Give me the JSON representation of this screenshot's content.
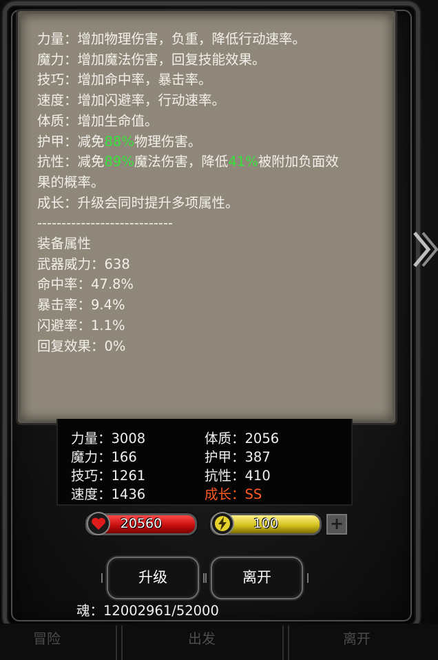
{
  "panel": {
    "lines": [
      {
        "parts": [
          {
            "t": "力量：增加物理伤害，负重，降低行动速率。"
          }
        ]
      },
      {
        "parts": [
          {
            "t": "魔力：增加魔法伤害，回复技能效果。"
          }
        ]
      },
      {
        "parts": [
          {
            "t": "技巧：增加命中率，暴击率。"
          }
        ]
      },
      {
        "parts": [
          {
            "t": "速度：增加闪避率，行动速率。"
          }
        ]
      },
      {
        "parts": [
          {
            "t": "体质：增加生命值。"
          }
        ]
      },
      {
        "parts": [
          {
            "t": "护甲：减免"
          },
          {
            "t": "88%",
            "g": true
          },
          {
            "t": "物理伤害。"
          }
        ]
      },
      {
        "parts": [
          {
            "t": "抗性：减免"
          },
          {
            "t": "89%",
            "g": true
          },
          {
            "t": "魔法伤害，降低"
          },
          {
            "t": "41%",
            "g": true
          },
          {
            "t": "被附加负面效果的概率。"
          }
        ]
      },
      {
        "parts": [
          {
            "t": "成长：升级会同时提升多项属性。"
          }
        ]
      },
      {
        "parts": [
          {
            "t": "----------------------------"
          }
        ]
      },
      {
        "parts": [
          {
            "t": "装备属性"
          }
        ]
      },
      {
        "parts": [
          {
            "t": "武器威力：638"
          }
        ]
      },
      {
        "parts": [
          {
            "t": "命中率：47.8%"
          }
        ]
      },
      {
        "parts": [
          {
            "t": "暴击率：9.4%"
          }
        ]
      },
      {
        "parts": [
          {
            "t": "闪避率：1.1%"
          }
        ]
      },
      {
        "parts": [
          {
            "t": "回复效果：0%"
          }
        ]
      }
    ]
  },
  "stats": {
    "strength": "力量：3008",
    "magic": "魔力：166",
    "skill": "技巧：1261",
    "speed": "速度：1436",
    "constitution": "体质：2056",
    "armor": "护甲：387",
    "resistance": "抗性：410",
    "growth": "成长：SS"
  },
  "bars": {
    "hp": "20560",
    "energy": "100"
  },
  "plus_label": "+",
  "buttons": {
    "upgrade": "升级",
    "leave": "离开"
  },
  "soul": "魂：12002961/52000",
  "bottom_tabs": {
    "adventure": "冒险",
    "depart": "出发",
    "leave": "离开"
  },
  "colors": {
    "green": "#35e23a",
    "growth": "#ff5a1f",
    "hp": "#d01010",
    "energy": "#d4c21e"
  }
}
